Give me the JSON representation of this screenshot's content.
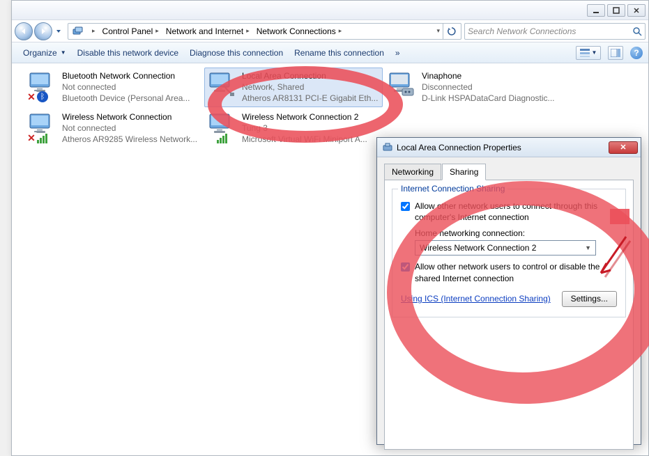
{
  "window": {
    "min_tip": "Minimize",
    "max_tip": "Restore",
    "close_tip": "Close"
  },
  "breadcrumb": {
    "items": [
      "Control Panel",
      "Network and Internet",
      "Network Connections",
      ""
    ]
  },
  "search": {
    "placeholder": "Search Network Connections"
  },
  "toolbar": {
    "organize": "Organize",
    "disable": "Disable this network device",
    "diagnose": "Diagnose this connection",
    "rename": "Rename this connection",
    "overflow": "»"
  },
  "connections": [
    {
      "title": "Bluetooth Network Connection",
      "status": "Not connected",
      "device": "Bluetooth Device (Personal Area...",
      "overlay": "x-bt"
    },
    {
      "title": "Local Area Connection",
      "status": "Network, Shared",
      "device": "Atheros AR8131 PCI-E Gigabit Eth...",
      "overlay": "",
      "selected": true
    },
    {
      "title": "Vinaphone",
      "status": "Disconnected",
      "device": "D-Link HSPADataCard Diagnostic...",
      "overlay": "modem"
    },
    {
      "title": "Wireless Network Connection",
      "status": "Not connected",
      "device": "Atheros AR9285 Wireless Network...",
      "overlay": "x-bars"
    },
    {
      "title": "Wireless Network Connection 2",
      "status": "Tung  3",
      "device": "Microsoft Virtual WiFi Miniport A...",
      "overlay": "bars"
    }
  ],
  "dialog": {
    "title": "Local Area Connection Properties",
    "tabs": [
      "Networking",
      "Sharing"
    ],
    "active_tab": 1,
    "legend": "Internet Connection Sharing",
    "chk1": "Allow other network users to connect through this computer's Internet connection",
    "home_label": "Home networking connection:",
    "home_value": "Wireless Network Connection 2",
    "chk2": "Allow other network users to control or disable the shared Internet connection",
    "ics_link": "Using ICS (Internet Connection Sharing)",
    "settings_btn": "Settings..."
  }
}
